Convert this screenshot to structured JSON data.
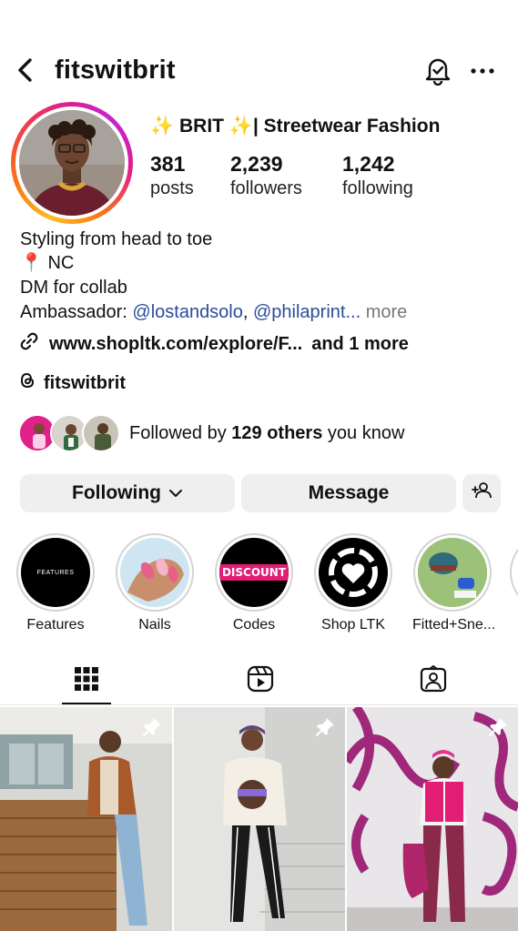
{
  "header": {
    "username": "fitswitbrit",
    "back_icon": "chevron-left-icon",
    "notification_icon": "bell-check-icon",
    "more_icon": "more-horizontal-icon"
  },
  "profile": {
    "display_name": "✨ BRIT ✨| Streetwear Fashion",
    "stats": [
      {
        "value": "381",
        "label": "posts"
      },
      {
        "value": "2,239",
        "label": "followers"
      },
      {
        "value": "1,242",
        "label": "following"
      }
    ],
    "bio": {
      "line1": "Styling from head to toe",
      "line2_pin": "📍",
      "line2_text": "NC",
      "line3": "DM for collab",
      "line4_prefix": "Ambassador: ",
      "mention1": "@lostandsolo",
      "separator": ", ",
      "mention2": "@philaprint",
      "ellipsis": "...",
      "more": "more"
    },
    "link": {
      "url": "www.shopltk.com/explore/F...",
      "extra": "and 1 more"
    },
    "threads": {
      "handle": "fitswitbrit"
    },
    "followed_by": {
      "prefix": "Followed by ",
      "bold": "129 others",
      "suffix": " you know"
    }
  },
  "actions": {
    "following_label": "Following",
    "message_label": "Message",
    "add_person_icon": "add-person-icon"
  },
  "highlights": [
    {
      "label": "Features",
      "cover_text": "FEATURES"
    },
    {
      "label": "Nails",
      "cover_text": ""
    },
    {
      "label": "Codes",
      "cover_text": "DISCOUNT"
    },
    {
      "label": "Shop LTK",
      "cover_text": ""
    },
    {
      "label": "Fitted+Sne...",
      "cover_text": ""
    }
  ],
  "tabs": [
    {
      "name": "grid",
      "icon": "grid-icon",
      "active": true
    },
    {
      "name": "reels",
      "icon": "reels-icon",
      "active": false
    },
    {
      "name": "tagged",
      "icon": "tagged-icon",
      "active": false
    }
  ],
  "colors": {
    "mention": "#2b4c9a",
    "button_bg": "#efefef",
    "story_ring_start": "#fbbf24",
    "story_ring_end": "#c026d3"
  }
}
